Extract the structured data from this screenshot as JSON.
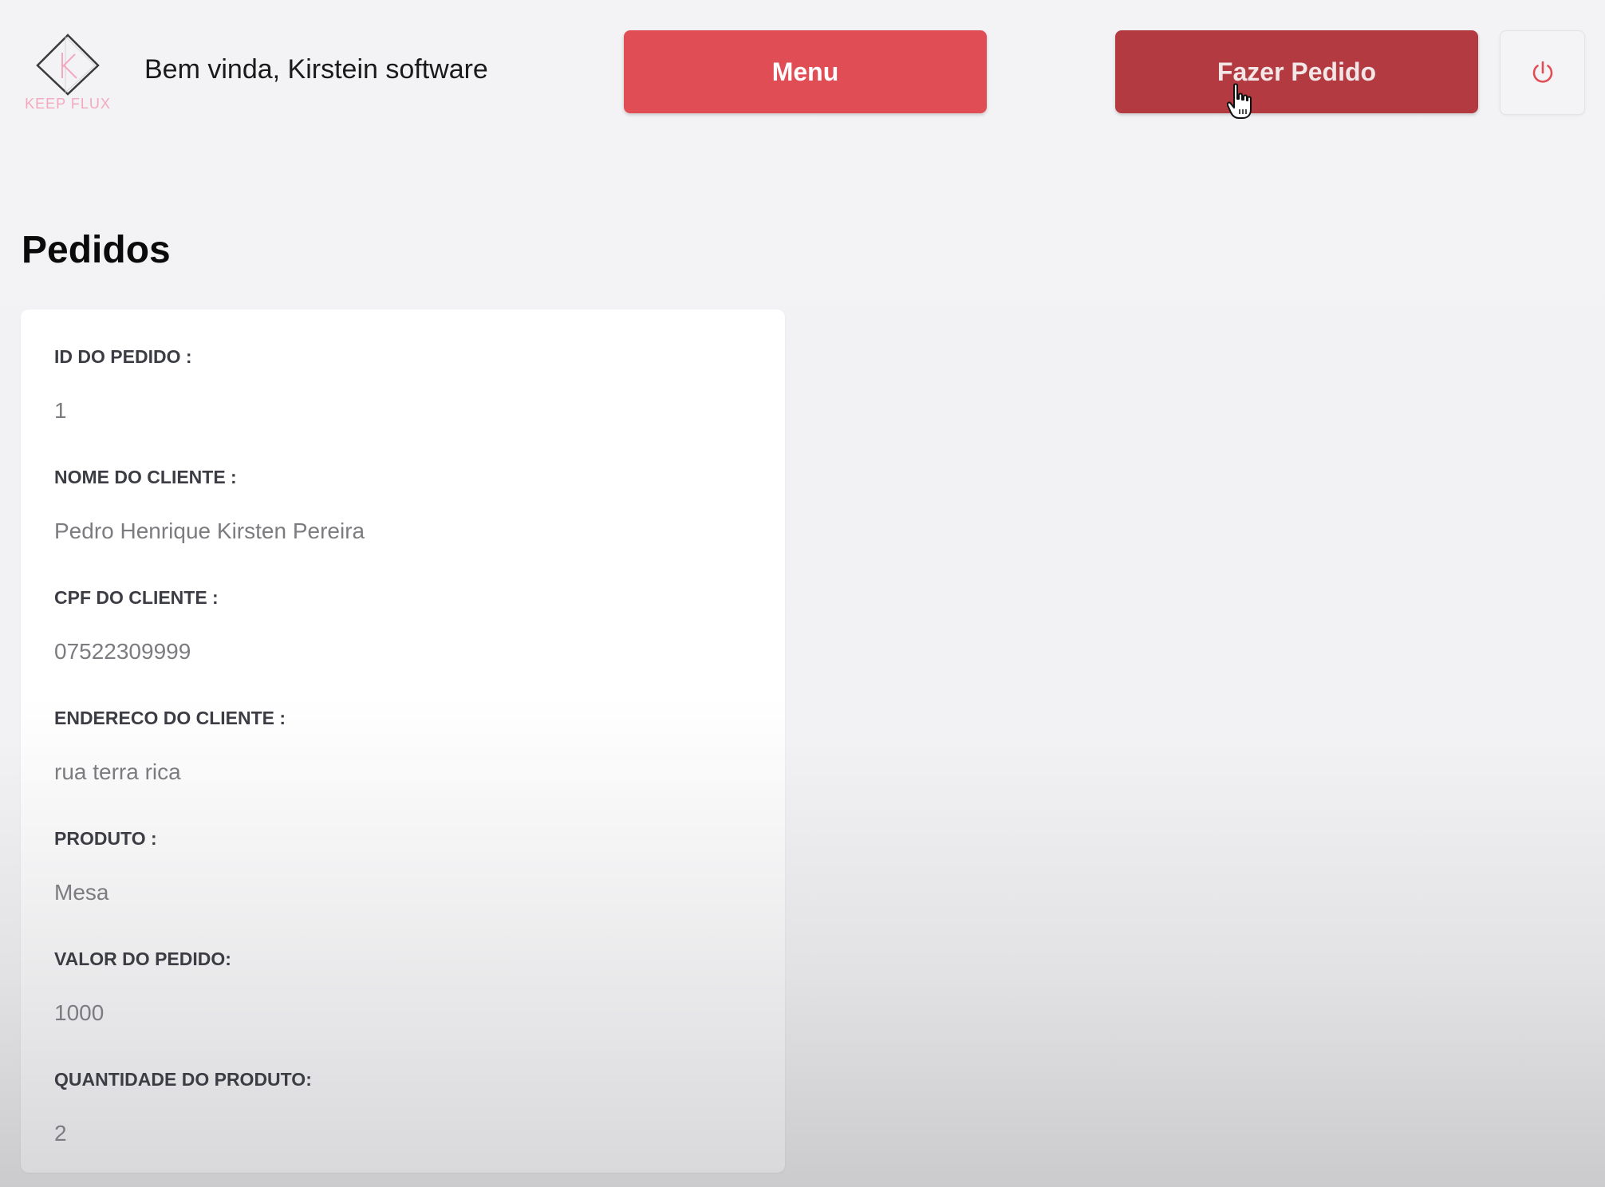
{
  "header": {
    "logo_text": "KEEP FLUX",
    "welcome": "Bem vinda, Kirstein software",
    "menu_label": "Menu",
    "order_label": "Fazer Pedido",
    "power_icon": "power-icon"
  },
  "page": {
    "title": "Pedidos"
  },
  "order": {
    "fields": [
      {
        "label": "ID DO PEDIDO :",
        "value": "1"
      },
      {
        "label": "NOME DO CLIENTE :",
        "value": "Pedro Henrique Kirsten Pereira"
      },
      {
        "label": "CPF DO CLIENTE :",
        "value": "07522309999"
      },
      {
        "label": "ENDERECO DO CLIENTE :",
        "value": "rua terra rica"
      },
      {
        "label": "PRODUTO :",
        "value": "Mesa"
      },
      {
        "label": "VALOR DO PEDIDO:",
        "value": "1000"
      },
      {
        "label": "QUANTIDADE DO PRODUTO:",
        "value": "2"
      }
    ]
  },
  "colors": {
    "menu_button": "#e14d55",
    "order_button_hover": "#b33a40",
    "logo_accent": "#f3a9bd",
    "power_icon": "#e14d55"
  }
}
